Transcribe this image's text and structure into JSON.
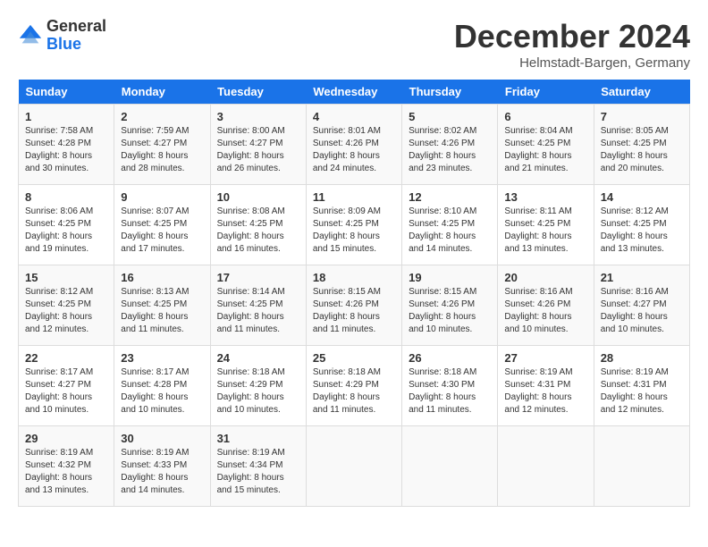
{
  "logo": {
    "general": "General",
    "blue": "Blue"
  },
  "header": {
    "title": "December 2024",
    "subtitle": "Helmstadt-Bargen, Germany"
  },
  "weekdays": [
    "Sunday",
    "Monday",
    "Tuesday",
    "Wednesday",
    "Thursday",
    "Friday",
    "Saturday"
  ],
  "weeks": [
    [
      {
        "day": "1",
        "info": "Sunrise: 7:58 AM\nSunset: 4:28 PM\nDaylight: 8 hours and 30 minutes."
      },
      {
        "day": "2",
        "info": "Sunrise: 7:59 AM\nSunset: 4:27 PM\nDaylight: 8 hours and 28 minutes."
      },
      {
        "day": "3",
        "info": "Sunrise: 8:00 AM\nSunset: 4:27 PM\nDaylight: 8 hours and 26 minutes."
      },
      {
        "day": "4",
        "info": "Sunrise: 8:01 AM\nSunset: 4:26 PM\nDaylight: 8 hours and 24 minutes."
      },
      {
        "day": "5",
        "info": "Sunrise: 8:02 AM\nSunset: 4:26 PM\nDaylight: 8 hours and 23 minutes."
      },
      {
        "day": "6",
        "info": "Sunrise: 8:04 AM\nSunset: 4:25 PM\nDaylight: 8 hours and 21 minutes."
      },
      {
        "day": "7",
        "info": "Sunrise: 8:05 AM\nSunset: 4:25 PM\nDaylight: 8 hours and 20 minutes."
      }
    ],
    [
      {
        "day": "8",
        "info": "Sunrise: 8:06 AM\nSunset: 4:25 PM\nDaylight: 8 hours and 19 minutes."
      },
      {
        "day": "9",
        "info": "Sunrise: 8:07 AM\nSunset: 4:25 PM\nDaylight: 8 hours and 17 minutes."
      },
      {
        "day": "10",
        "info": "Sunrise: 8:08 AM\nSunset: 4:25 PM\nDaylight: 8 hours and 16 minutes."
      },
      {
        "day": "11",
        "info": "Sunrise: 8:09 AM\nSunset: 4:25 PM\nDaylight: 8 hours and 15 minutes."
      },
      {
        "day": "12",
        "info": "Sunrise: 8:10 AM\nSunset: 4:25 PM\nDaylight: 8 hours and 14 minutes."
      },
      {
        "day": "13",
        "info": "Sunrise: 8:11 AM\nSunset: 4:25 PM\nDaylight: 8 hours and 13 minutes."
      },
      {
        "day": "14",
        "info": "Sunrise: 8:12 AM\nSunset: 4:25 PM\nDaylight: 8 hours and 13 minutes."
      }
    ],
    [
      {
        "day": "15",
        "info": "Sunrise: 8:12 AM\nSunset: 4:25 PM\nDaylight: 8 hours and 12 minutes."
      },
      {
        "day": "16",
        "info": "Sunrise: 8:13 AM\nSunset: 4:25 PM\nDaylight: 8 hours and 11 minutes."
      },
      {
        "day": "17",
        "info": "Sunrise: 8:14 AM\nSunset: 4:25 PM\nDaylight: 8 hours and 11 minutes."
      },
      {
        "day": "18",
        "info": "Sunrise: 8:15 AM\nSunset: 4:26 PM\nDaylight: 8 hours and 11 minutes."
      },
      {
        "day": "19",
        "info": "Sunrise: 8:15 AM\nSunset: 4:26 PM\nDaylight: 8 hours and 10 minutes."
      },
      {
        "day": "20",
        "info": "Sunrise: 8:16 AM\nSunset: 4:26 PM\nDaylight: 8 hours and 10 minutes."
      },
      {
        "day": "21",
        "info": "Sunrise: 8:16 AM\nSunset: 4:27 PM\nDaylight: 8 hours and 10 minutes."
      }
    ],
    [
      {
        "day": "22",
        "info": "Sunrise: 8:17 AM\nSunset: 4:27 PM\nDaylight: 8 hours and 10 minutes."
      },
      {
        "day": "23",
        "info": "Sunrise: 8:17 AM\nSunset: 4:28 PM\nDaylight: 8 hours and 10 minutes."
      },
      {
        "day": "24",
        "info": "Sunrise: 8:18 AM\nSunset: 4:29 PM\nDaylight: 8 hours and 10 minutes."
      },
      {
        "day": "25",
        "info": "Sunrise: 8:18 AM\nSunset: 4:29 PM\nDaylight: 8 hours and 11 minutes."
      },
      {
        "day": "26",
        "info": "Sunrise: 8:18 AM\nSunset: 4:30 PM\nDaylight: 8 hours and 11 minutes."
      },
      {
        "day": "27",
        "info": "Sunrise: 8:19 AM\nSunset: 4:31 PM\nDaylight: 8 hours and 12 minutes."
      },
      {
        "day": "28",
        "info": "Sunrise: 8:19 AM\nSunset: 4:31 PM\nDaylight: 8 hours and 12 minutes."
      }
    ],
    [
      {
        "day": "29",
        "info": "Sunrise: 8:19 AM\nSunset: 4:32 PM\nDaylight: 8 hours and 13 minutes."
      },
      {
        "day": "30",
        "info": "Sunrise: 8:19 AM\nSunset: 4:33 PM\nDaylight: 8 hours and 14 minutes."
      },
      {
        "day": "31",
        "info": "Sunrise: 8:19 AM\nSunset: 4:34 PM\nDaylight: 8 hours and 15 minutes."
      },
      null,
      null,
      null,
      null
    ]
  ]
}
